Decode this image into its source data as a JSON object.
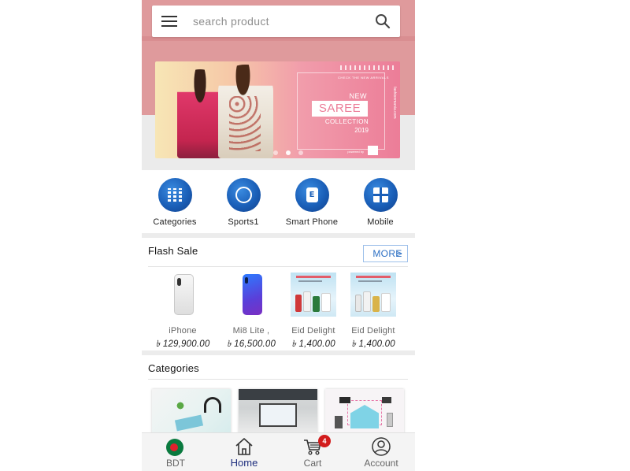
{
  "search": {
    "placeholder": "search product"
  },
  "banner": {
    "small_top": "CHECK THE NEW ARRIVALS",
    "line_new": "NEW",
    "line_saree": "SAREE",
    "line_collection": "COLLECTION",
    "line_year": "2019",
    "vertical_text": "fashionmania.com",
    "powered_by": "powered by",
    "slide_count": 3,
    "active_slide": 2
  },
  "quick_categories": [
    {
      "label": "Categories",
      "icon": "grid-icon"
    },
    {
      "label": "Sports1",
      "icon": "ring-icon"
    },
    {
      "label": "Smart Phone",
      "icon": "e-icon"
    },
    {
      "label": "Mobile",
      "icon": "gift-icon"
    }
  ],
  "flash_sale": {
    "title": "Flash Sale",
    "more_label": "MORE",
    "more_arrow": ">",
    "products": [
      {
        "name": "iPhone",
        "price": "৳ 129,900.00",
        "image": "white-phone"
      },
      {
        "name": "Mi8 Lite ,",
        "price": "৳ 16,500.00",
        "image": "blue-phone"
      },
      {
        "name": "Eid Delight",
        "price": "৳ 1,400.00",
        "image": "cosmetics-combo"
      },
      {
        "name": "Eid Delight",
        "price": "৳ 1,400.00",
        "image": "cosmetics-combo"
      }
    ]
  },
  "categories": {
    "title": "Categories"
  },
  "bottom_nav": {
    "items": [
      {
        "label": "BDT",
        "icon": "bangladesh-flag-icon"
      },
      {
        "label": "Home",
        "icon": "home-icon",
        "active": true
      },
      {
        "label": "Cart",
        "icon": "cart-icon",
        "badge": "4"
      },
      {
        "label": "Account",
        "icon": "account-icon"
      }
    ]
  },
  "colors": {
    "header_pink": "#df9a9c",
    "accent_blue": "#1a5fb8",
    "active_nav": "#1d2d7d",
    "badge_red": "#d21c1c"
  }
}
